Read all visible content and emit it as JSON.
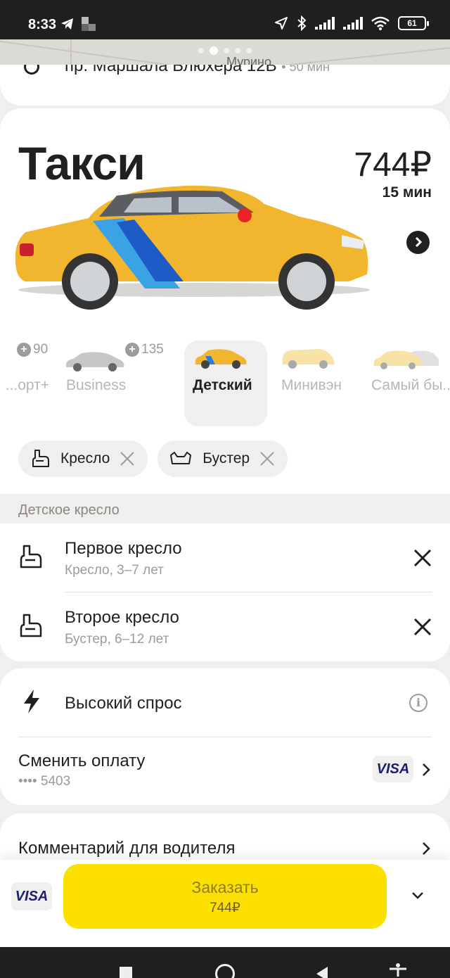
{
  "status_bar": {
    "time": "8:33",
    "battery": "61"
  },
  "map": {
    "street_label": "Мурино"
  },
  "address": {
    "text": "пр. Маршала Блюхера 12В",
    "eta": "• 50 мин"
  },
  "tariff": {
    "title": "Такси",
    "price": "744₽",
    "eta": "15 мин"
  },
  "tariffs": [
    {
      "label": "...орт+",
      "bonus": "90"
    },
    {
      "label": "Business",
      "bonus": "135"
    },
    {
      "label": "Детский",
      "bonus": ""
    },
    {
      "label": "Минивэн",
      "bonus": ""
    },
    {
      "label": "Самый бы...",
      "bonus": ""
    }
  ],
  "chips": [
    {
      "label": "Кресло"
    },
    {
      "label": "Бустер"
    }
  ],
  "child_seat_section": {
    "heading": "Детское кресло",
    "seats": [
      {
        "title": "Первое кресло",
        "subtitle": "Кресло, 3–7 лет"
      },
      {
        "title": "Второе кресло",
        "subtitle": "Бустер, 6–12 лет"
      }
    ]
  },
  "options": {
    "demand_label": "Высокий спрос",
    "payment_label": "Сменить оплату",
    "card_masked": "•••• 5403",
    "payment_brand": "VISA"
  },
  "comment": {
    "label": "Комментарий для водителя"
  },
  "order": {
    "payment_brand": "VISA",
    "button_label": "Заказать",
    "button_price": "744₽"
  },
  "colors": {
    "accent": "#fce000",
    "background": "#f0efed",
    "text": "#21201f",
    "muted": "#9e9b98"
  }
}
